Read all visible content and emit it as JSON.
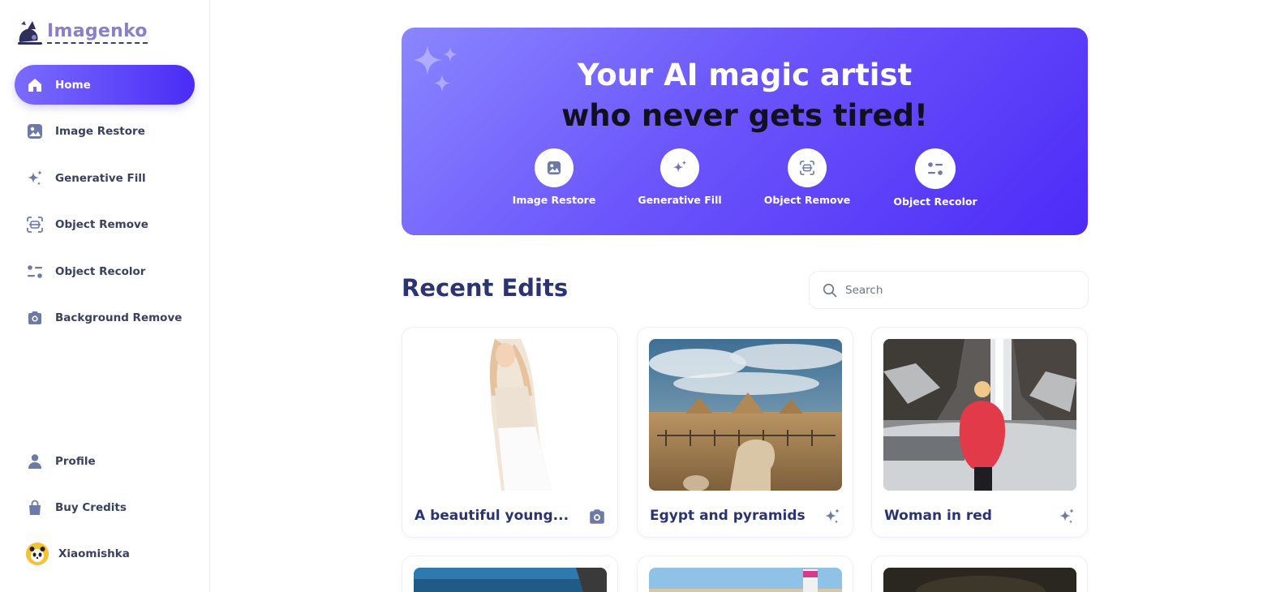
{
  "app": {
    "name": "Imagenko"
  },
  "sidebar": {
    "items": [
      {
        "label": "Home",
        "icon": "home-icon",
        "active": true
      },
      {
        "label": "Image Restore",
        "icon": "image-icon",
        "active": false
      },
      {
        "label": "Generative Fill",
        "icon": "sparkles-icon",
        "active": false
      },
      {
        "label": "Object Remove",
        "icon": "object-remove-icon",
        "active": false
      },
      {
        "label": "Object Recolor",
        "icon": "recolor-icon",
        "active": false
      },
      {
        "label": "Background Remove",
        "icon": "camera-icon",
        "active": false
      }
    ],
    "bottom": [
      {
        "label": "Profile",
        "icon": "user-icon"
      },
      {
        "label": "Buy Credits",
        "icon": "bag-icon"
      }
    ],
    "user": {
      "name": "Xiaomishka",
      "avatar": "panda-avatar"
    }
  },
  "hero": {
    "line1": "Your AI magic artist",
    "line2": "who never gets tired!",
    "actions": [
      {
        "label": "Image Restore",
        "icon": "image-icon"
      },
      {
        "label": "Generative Fill",
        "icon": "sparkles-icon"
      },
      {
        "label": "Object Remove",
        "icon": "object-remove-icon"
      },
      {
        "label": "Object Recolor",
        "icon": "recolor-icon"
      }
    ]
  },
  "recent": {
    "title": "Recent Edits",
    "search_placeholder": "Search",
    "cards": [
      {
        "title": "A beautiful young...",
        "type_icon": "camera-icon"
      },
      {
        "title": "Egypt and pyramids",
        "type_icon": "sparkles-icon"
      },
      {
        "title": "Woman in red",
        "type_icon": "sparkles-icon"
      }
    ]
  },
  "colors": {
    "accent": "#5b3cf8",
    "accent_light": "#8a86ff",
    "nav_icon": "#6e7aa6",
    "heading": "#2b3470"
  }
}
